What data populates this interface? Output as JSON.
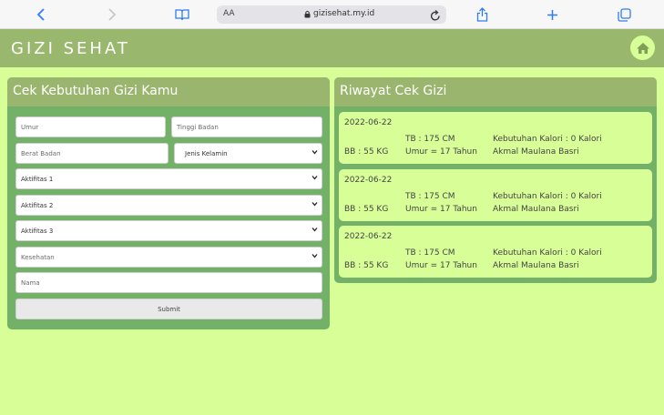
{
  "browser": {
    "aa_label": "AA",
    "url": "gizisehat.my.id"
  },
  "header": {
    "title": "GIZI SEHAT"
  },
  "form": {
    "title": "Cek Kebutuhan Gizi Kamu",
    "umur_placeholder": "Umur",
    "tinggi_placeholder": "Tinggi Badan",
    "berat_placeholder": "Berat Badan",
    "jenis_kelamin": "Jenis Kelamin",
    "aktifitas1": "Aktifitas 1",
    "aktifitas2": "Aktifitas 2",
    "aktifitas3": "Aktifitas 3",
    "kesehatan": "Kesehatan",
    "nama_placeholder": "Nama",
    "submit_label": "Submit"
  },
  "history": {
    "title": "Riwayat Cek Gizi",
    "items": [
      {
        "date": "2022-06-22",
        "tb": "TB : 175 CM",
        "bb": "BB : 55 KG",
        "umur": "Umur = 17 Tahun",
        "kalori": "Kebutuhan Kalori : 0 Kalori",
        "nama": "Akmal Maulana Basri"
      },
      {
        "date": "2022-06-22",
        "tb": "TB : 175 CM",
        "bb": "BB : 55 KG",
        "umur": "Umur = 17 Tahun",
        "kalori": "Kebutuhan Kalori : 0 Kalori",
        "nama": "Akmal Maulana Basri"
      },
      {
        "date": "2022-06-22",
        "tb": "TB : 175 CM",
        "bb": "BB : 55 KG",
        "umur": "Umur = 17 Tahun",
        "kalori": "Kebutuhan Kalori : 0 Kalori",
        "nama": "Akmal Maulana Basri"
      }
    ]
  },
  "colors": {
    "background": "#d8fe97",
    "header": "#99b76d",
    "card_body": "#73b168",
    "accent_blue": "#2f7df6"
  }
}
